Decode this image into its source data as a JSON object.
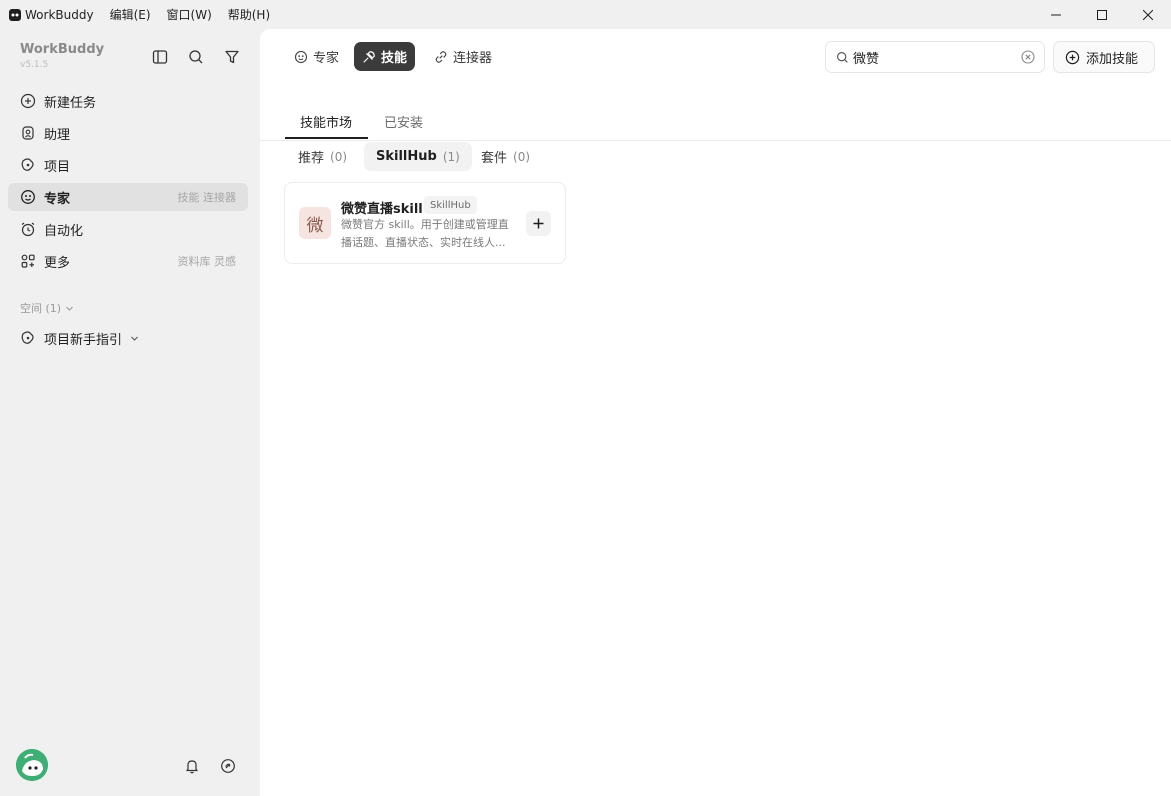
{
  "titlebar": {
    "app_name": "WorkBuddy",
    "menus": [
      "编辑(E)",
      "窗口(W)",
      "帮助(H)"
    ]
  },
  "sidebar": {
    "brand": "WorkBuddy",
    "version": "v5.1.5",
    "items": [
      {
        "label": "新建任务",
        "icon": "plus-circle-icon"
      },
      {
        "label": "助理",
        "icon": "assistant-icon"
      },
      {
        "label": "项目",
        "icon": "project-icon"
      },
      {
        "label": "专家",
        "icon": "expert-icon",
        "hint": "技能 连接器",
        "active": true
      },
      {
        "label": "自动化",
        "icon": "alarm-clock-icon"
      },
      {
        "label": "更多",
        "icon": "grid-icon",
        "hint": "资料库 灵感"
      }
    ],
    "space_header": "空间 (1)",
    "space_item": "项目新手指引"
  },
  "main": {
    "top_tabs": [
      {
        "label": "专家",
        "active": false
      },
      {
        "label": "技能",
        "active": true
      },
      {
        "label": "连接器",
        "active": false
      }
    ],
    "search": {
      "value": "微赞",
      "placeholder": ""
    },
    "add_skill_label": "添加技能",
    "sub_tabs": [
      "技能市场",
      "已安装"
    ],
    "chips": [
      {
        "label": "推荐",
        "count": "(0)"
      },
      {
        "label": "SkillHub",
        "count": "(1)",
        "active": true
      },
      {
        "label": "套件",
        "count": "(0)"
      }
    ],
    "card": {
      "icon_char": "微",
      "title": "微赞直播skill",
      "tag": "SkillHub",
      "description": "微赞官方 skill。用于创建或管理直播话题、直播状态、实时在线人..."
    }
  },
  "colors": {
    "sidebar_bg": "#f0f0f0",
    "active_tab_bg": "#3b3b3b",
    "avatar_green": "#3fae74"
  }
}
